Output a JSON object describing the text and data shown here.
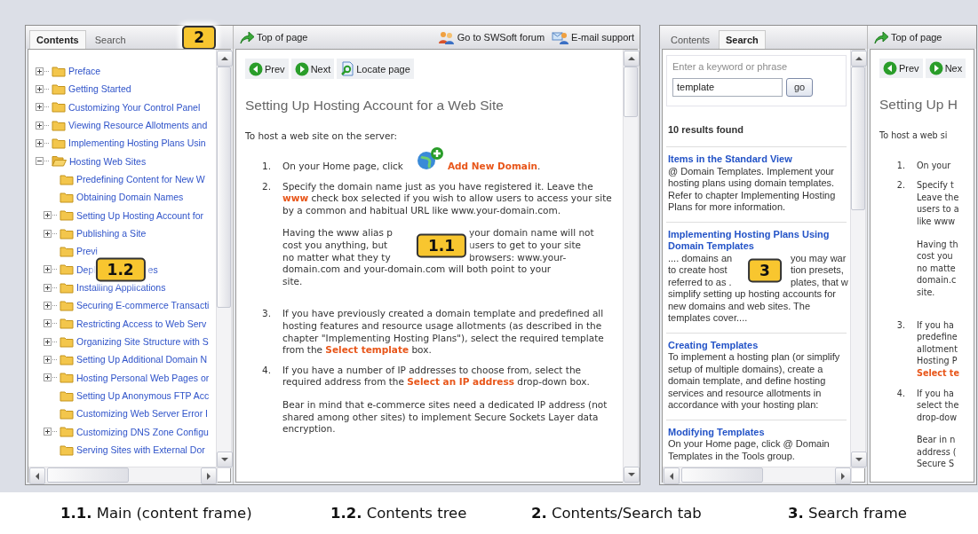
{
  "left_window": {
    "sidebar": {
      "kind": "contents",
      "tabs": [
        {
          "label": "Contents",
          "selected": true
        },
        {
          "label": "Search",
          "selected": false
        }
      ],
      "tab_callout": "2",
      "tree_callout": "1.2",
      "tree": [
        {
          "label": "Preface",
          "expandable": true,
          "expanded": false
        },
        {
          "label": "Getting Started",
          "expandable": true,
          "expanded": false
        },
        {
          "label": "Customizing Your Control Panel",
          "expandable": true,
          "expanded": false
        },
        {
          "label": "Viewing Resource Allotments and",
          "expandable": true,
          "expanded": false
        },
        {
          "label": "Implementing Hosting Plans Usin",
          "expandable": true,
          "expanded": false
        },
        {
          "label": "Hosting Web Sites",
          "expandable": true,
          "expanded": true,
          "children": [
            {
              "label": "Predefining Content for New W",
              "expandable": false,
              "expanded": false
            },
            {
              "label": "Obtaining Domain Names",
              "expandable": false,
              "expanded": false
            },
            {
              "label": "Setting Up Hosting Account for",
              "expandable": true,
              "expanded": false
            },
            {
              "label": "Publishing a Site",
              "expandable": true,
              "expanded": false
            },
            {
              "label": "Previ",
              "expandable": false,
              "expanded": false
            },
            {
              "label": "Depl",
              "label_after": "es",
              "expandable": true,
              "expanded": false
            },
            {
              "label": "Installing Applications",
              "expandable": true,
              "expanded": false
            },
            {
              "label": "Securing E-commerce Transacti",
              "expandable": true,
              "expanded": false
            },
            {
              "label": "Restricting Access to Web Serv",
              "expandable": true,
              "expanded": false
            },
            {
              "label": "Organizing Site Structure with S",
              "expandable": true,
              "expanded": false
            },
            {
              "label": "Setting Up Additional Domain N",
              "expandable": true,
              "expanded": false
            },
            {
              "label": "Hosting Personal Web Pages or",
              "expandable": true,
              "expanded": false
            },
            {
              "label": "Setting Up Anonymous FTP Acc",
              "expandable": false,
              "expanded": false
            },
            {
              "label": "Customizing Web Server Error I",
              "expandable": false,
              "expanded": false
            },
            {
              "label": "Customizing DNS Zone Configu",
              "expandable": true,
              "expanded": false
            },
            {
              "label": "Serving Sites with External Dor",
              "expandable": false,
              "expanded": false
            }
          ]
        }
      ]
    },
    "toolbar": {
      "top_link": "Top of page",
      "links": [
        "Go to SWSoft forum",
        "E-mail support"
      ]
    },
    "content": {
      "nav": [
        "Prev",
        "Next",
        "Locate page"
      ],
      "heading": "Setting Up Hosting Account for a Web Site",
      "intro": "To host a web site on the server:",
      "callout": "1.1",
      "steps": [
        {
          "number": "1.",
          "kind": "click",
          "text": "On your Home page, click",
          "after_icon": "**Add New Domain**."
        },
        {
          "number": "2.",
          "kind": "plain",
          "text": "Specify the domain name just as you have registered it. Leave the **www** check box selected if you wish to allow users to access your site by a common and habitual URL like www.your-domain.com.",
          "note_lines": [
            [
              "Having the www alias p",
              "your domain name will not"
            ],
            [
              "cost you anything, but",
              "users to get to your site"
            ],
            [
              "no matter what they ty",
              "browsers: www.your-"
            ],
            [
              "domain.com and your-domain.com will both point to your"
            ],
            [
              "site."
            ]
          ]
        },
        {
          "number": "3.",
          "kind": "plain",
          "text": "If you have previously created a domain template and predefined all hosting features and resource usage allotments (as described in the chapter \"Implementing Hosting Plans\"), select the required template from the **Select template** box."
        },
        {
          "number": "4.",
          "kind": "plain",
          "text": "If you have a number of IP addresses to choose from, select the required address from the **Select an IP address** drop-down box.",
          "note": "Bear in mind that e-commerce sites need a dedicated IP address (not shared among other sites) to implement Secure Sockets Layer data encryption."
        }
      ]
    }
  },
  "right_window": {
    "sidebar": {
      "kind": "search",
      "tabs": [
        {
          "label": "Contents",
          "selected": false
        },
        {
          "label": "Search",
          "selected": true
        }
      ],
      "prompt": "Enter a keyword or phrase",
      "query": "template",
      "button": "go",
      "summary": "10 results found",
      "callout": "3",
      "results": [
        {
          "title": "Items in the Standard View",
          "body": "@ Domain Templates. Implement your hosting plans using domain templates. Refer to chapter Implementing Hosting Plans for more information."
        },
        {
          "title": "Implementing Hosting Plans Using Domain Templates",
          "body_lines": [
            [
              ".... domains an",
              "you may war"
            ],
            [
              "to create host",
              "tion presets,"
            ],
            [
              "referred to as .",
              "plates, that w"
            ],
            [
              "simplify setting up hosting accounts for"
            ],
            [
              "new domains and web sites. The"
            ],
            [
              "templates cover...."
            ]
          ]
        },
        {
          "title": "Creating Templates",
          "body": "To implement a hosting plan (or simplify setup of multiple domains), create a domain template, and define hosting services and resource allotments in accordance with your hosting plan:"
        },
        {
          "title": "Modifying Templates",
          "body": "On your Home page, click @ Domain Templates in the Tools group."
        }
      ]
    },
    "toolbar": {
      "top_link": "Top of page"
    },
    "content": {
      "nav": [
        "Prev",
        "Nex"
      ],
      "heading": "Setting Up H",
      "intro": "To host a web si",
      "steps": [
        {
          "number": "1.",
          "kind": "plain",
          "lines": [
            "On your"
          ]
        },
        {
          "number": "2.",
          "kind": "plain",
          "lines": [
            "Specify t",
            "Leave the",
            "users to a",
            "like www"
          ],
          "note_lines": [
            [
              "Having th"
            ],
            [
              "cost you"
            ],
            [
              "no matte"
            ],
            [
              "domain.c"
            ],
            [
              "site."
            ]
          ]
        },
        {
          "number": "3.",
          "kind": "plain",
          "lines": [
            "If you ha",
            "predefine",
            "allotment",
            "Hosting P",
            "**Select te**"
          ]
        },
        {
          "number": "4.",
          "kind": "plain",
          "lines": [
            "If you ha",
            "select the",
            "drop-dow"
          ],
          "note_lines": [
            [
              "Bear in n"
            ],
            [
              "address ("
            ],
            [
              "Secure S"
            ]
          ]
        }
      ]
    }
  },
  "legend": [
    "**1.1.** Main (content frame)",
    "**1.2.** Contents tree",
    "**2.** Contents/Search tab",
    "**3.** Search frame"
  ]
}
